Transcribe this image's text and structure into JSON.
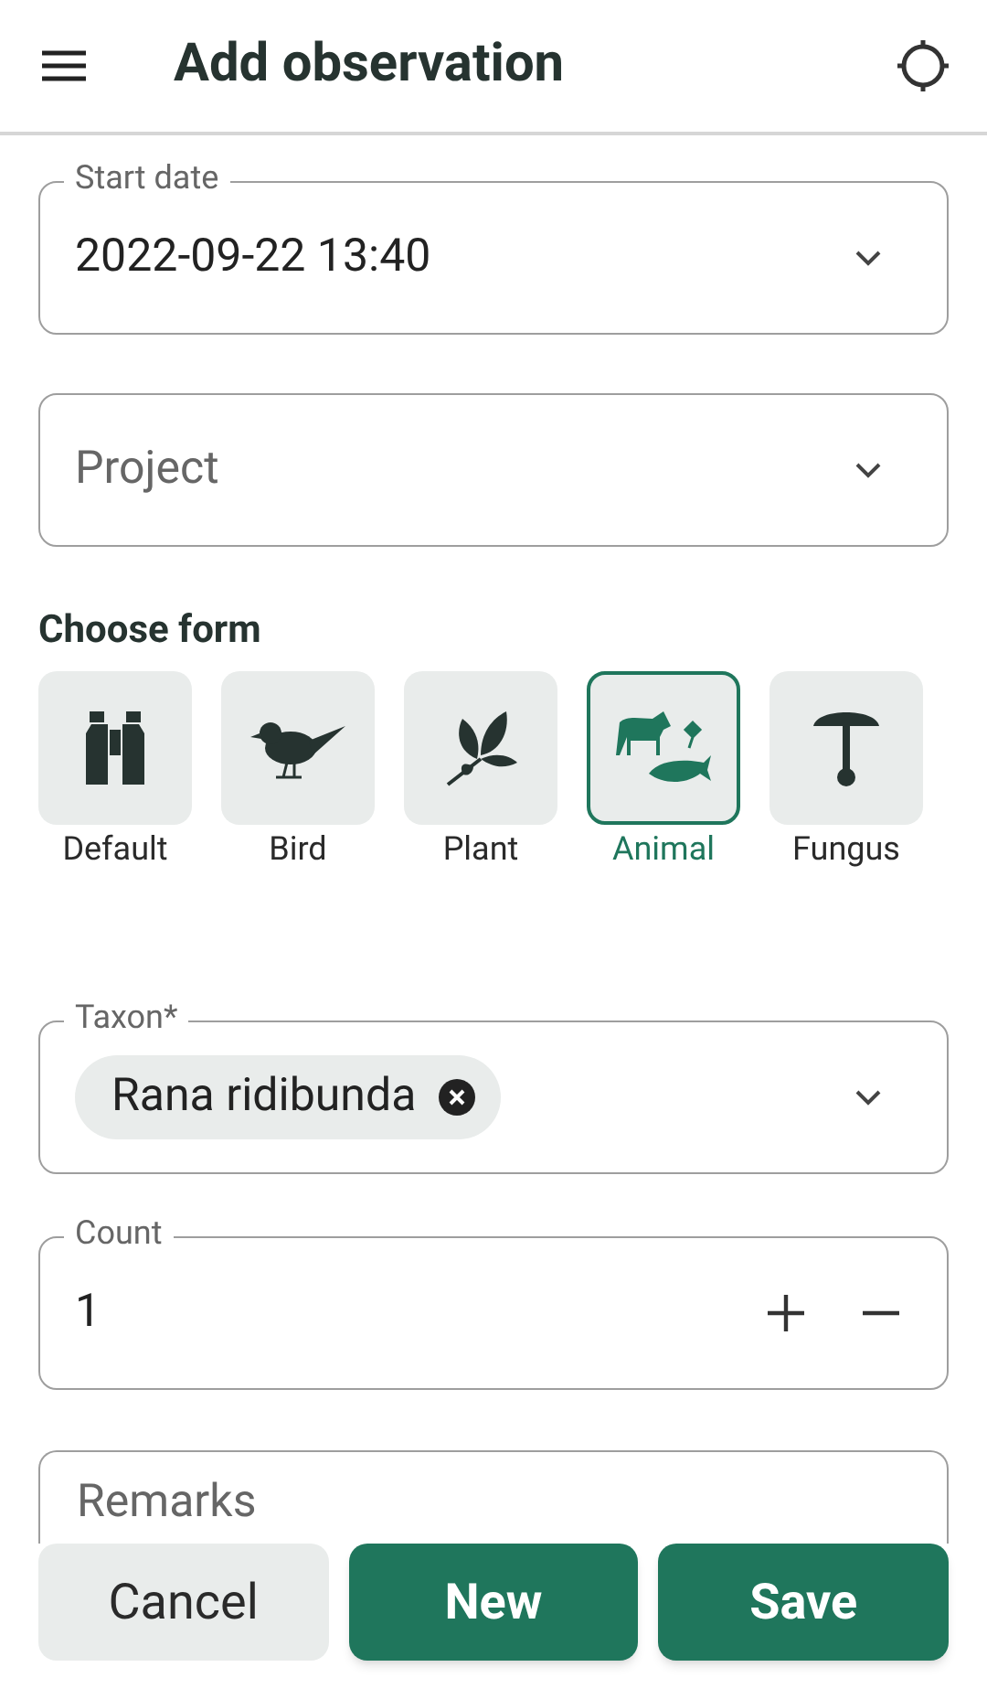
{
  "header": {
    "title": "Add observation"
  },
  "start_date": {
    "label": "Start date",
    "value": "2022-09-22 13:40"
  },
  "project": {
    "placeholder": "Project"
  },
  "choose_form": {
    "title": "Choose form",
    "forms": [
      {
        "kind": "binoculars",
        "label": "Default",
        "selected": false
      },
      {
        "kind": "bird",
        "label": "Bird",
        "selected": false
      },
      {
        "kind": "plant",
        "label": "Plant",
        "selected": false
      },
      {
        "kind": "animal",
        "label": "Animal",
        "selected": true
      },
      {
        "kind": "fungus",
        "label": "Fungus",
        "selected": false
      }
    ]
  },
  "taxon": {
    "label": "Taxon*",
    "chip": "Rana ridibunda"
  },
  "count": {
    "label": "Count",
    "value": "1"
  },
  "remarks": {
    "placeholder": "Remarks"
  },
  "buttons": [
    {
      "kind": "secondary",
      "label": "Cancel"
    },
    {
      "kind": "primary",
      "label": "New"
    },
    {
      "kind": "primary",
      "label": "Save"
    }
  ]
}
